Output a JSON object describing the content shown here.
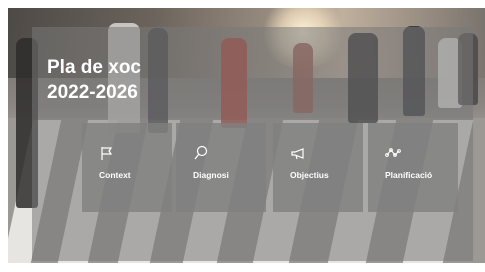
{
  "hero": {
    "title_line1": "Pla de xoc",
    "title_line2": "2022-2026"
  },
  "cards": [
    {
      "label": "Context",
      "icon": "flag-icon"
    },
    {
      "label": "Diagnosi",
      "icon": "search-icon"
    },
    {
      "label": "Objectius",
      "icon": "megaphone-icon"
    },
    {
      "label": "Planificació",
      "icon": "network-icon"
    }
  ]
}
